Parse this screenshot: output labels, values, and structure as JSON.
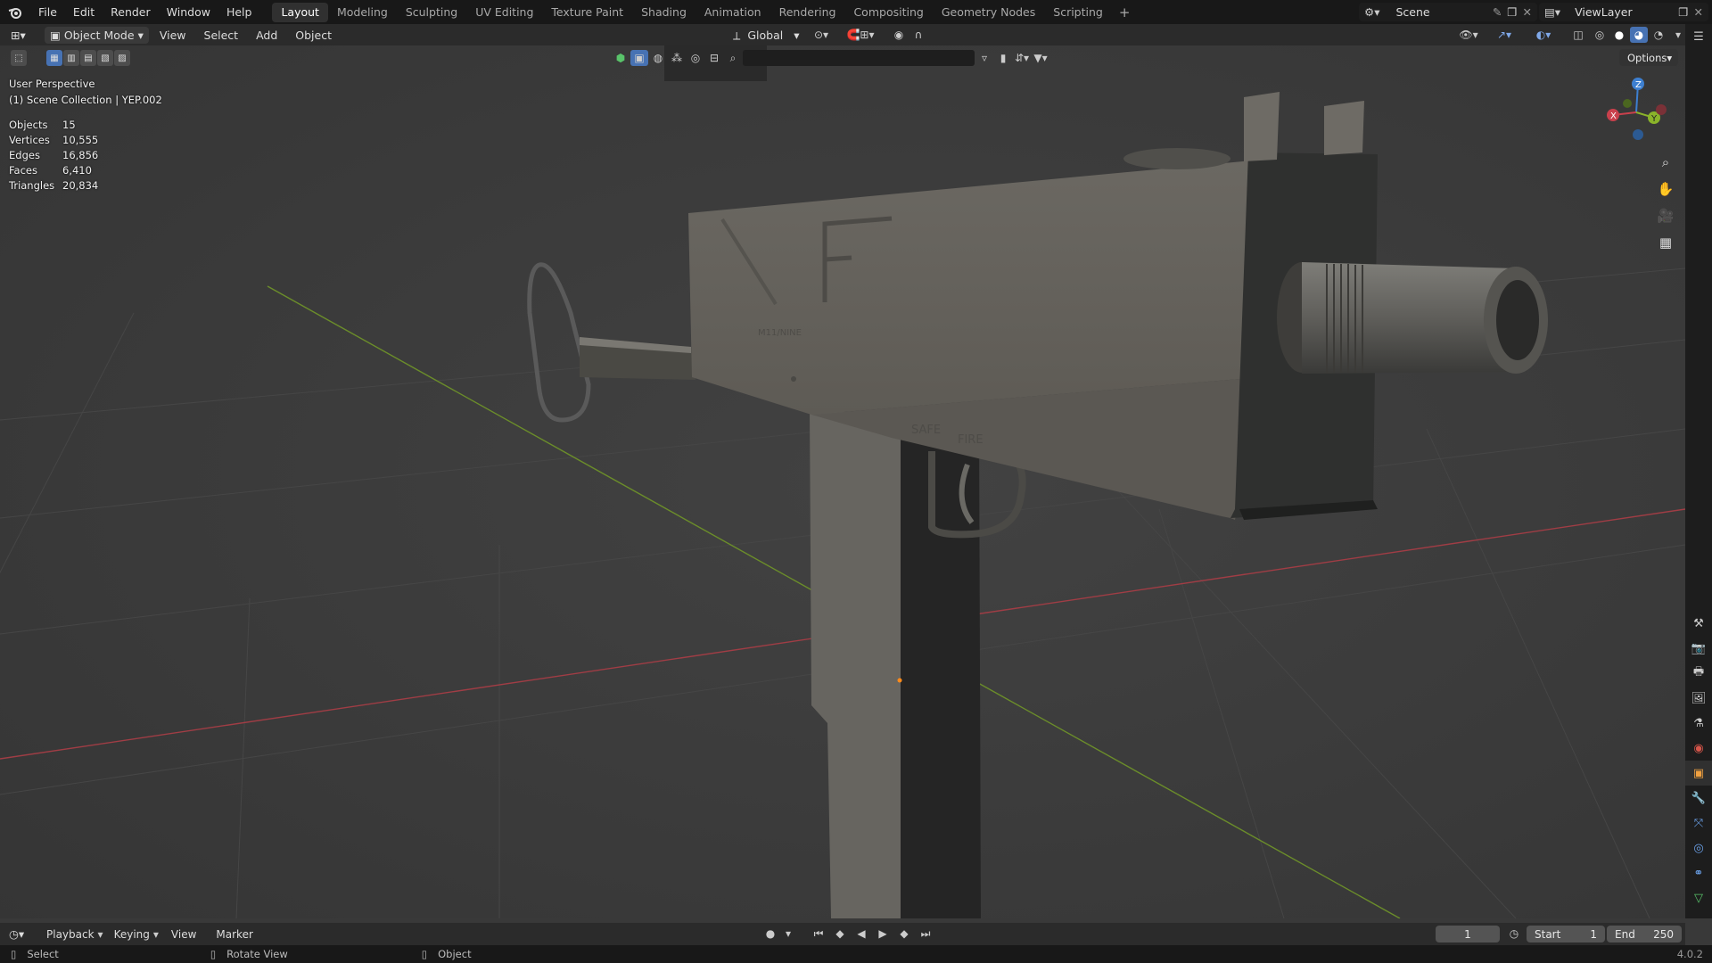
{
  "menu": [
    "File",
    "Edit",
    "Render",
    "Window",
    "Help"
  ],
  "workspaces": [
    {
      "label": "Layout",
      "active": true
    },
    {
      "label": "Modeling"
    },
    {
      "label": "Sculpting"
    },
    {
      "label": "UV Editing"
    },
    {
      "label": "Texture Paint"
    },
    {
      "label": "Shading"
    },
    {
      "label": "Animation"
    },
    {
      "label": "Rendering"
    },
    {
      "label": "Compositing"
    },
    {
      "label": "Geometry Nodes"
    },
    {
      "label": "Scripting"
    }
  ],
  "scene_name": "Scene",
  "view_layer": "ViewLayer",
  "header": {
    "mode": "Object Mode",
    "menus": [
      "View",
      "Select",
      "Add",
      "Object"
    ],
    "transform_orientation": "Global",
    "options": "Options"
  },
  "viewport": {
    "perspective": "User Perspective",
    "collection": "(1) Scene Collection | YEP.002",
    "stats": [
      {
        "k": "Objects",
        "v": "15"
      },
      {
        "k": "Vertices",
        "v": "10,555"
      },
      {
        "k": "Edges",
        "v": "16,856"
      },
      {
        "k": "Faces",
        "v": "6,410"
      },
      {
        "k": "Triangles",
        "v": "20,834"
      }
    ],
    "gizmo": {
      "x": "X",
      "y": "Y",
      "z": "Z"
    },
    "model_text": {
      "brand": "M11/NINE",
      "semi": "SAFE",
      "fire": "FIRE"
    }
  },
  "timeline": {
    "menus": [
      "Playback",
      "Keying",
      "View",
      "Marker"
    ],
    "current_frame": "1",
    "start_label": "Start",
    "start": "1",
    "end_label": "End",
    "end": "250"
  },
  "status": {
    "select": "Select",
    "rotate": "Rotate View",
    "object": "Object",
    "version": "4.0.2"
  },
  "colors": {
    "accent": "#4772b3",
    "x_axis": "#c9404c",
    "y_axis": "#8ab32a",
    "z_axis": "#3d7fd0"
  }
}
